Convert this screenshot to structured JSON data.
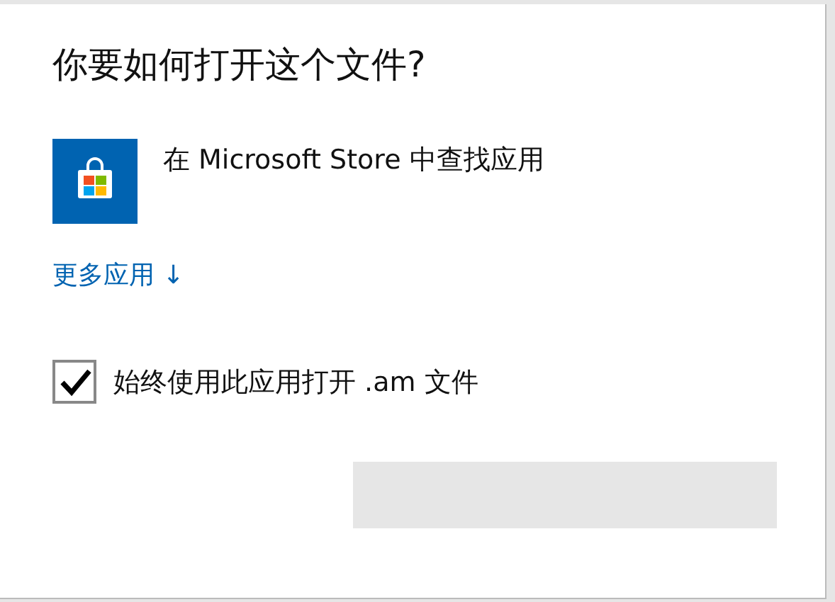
{
  "dialog": {
    "title": "你要如何打开这个文件?",
    "apps": [
      {
        "kind": "store",
        "label": "在 Microsoft Store 中查找应用"
      }
    ],
    "more_link": {
      "label": "更多应用",
      "arrow": "↓"
    },
    "always_use": {
      "label": "始终使用此应用打开 .am 文件",
      "checked": true
    }
  }
}
